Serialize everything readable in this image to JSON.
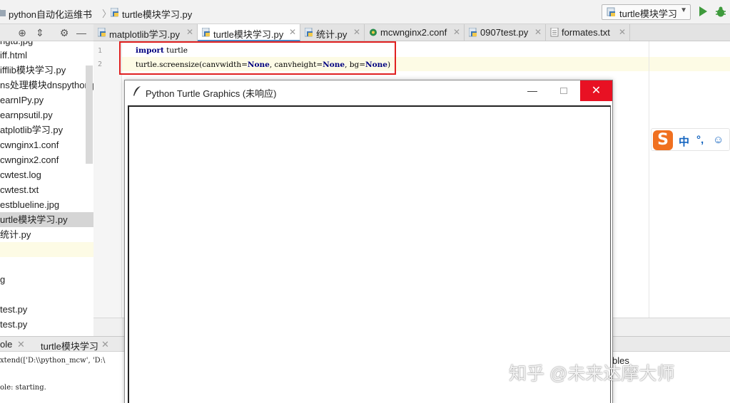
{
  "navbar": {
    "breadcrumb_project": "python自动化运维书",
    "breadcrumb_file": "turtle模块学习.py",
    "run_config": "turtle模块学习"
  },
  "tabs": [
    {
      "label": "matplotlib学习.py"
    },
    {
      "label": "turtle模块学习.py",
      "active": true
    },
    {
      "label": "统计.py"
    },
    {
      "label": "mcwnginx2.conf"
    },
    {
      "label": "0907test.py"
    },
    {
      "label": "formates.txt"
    }
  ],
  "tree": [
    "ngtu.jpg",
    "iff.html",
    "ifflib模块学习.py",
    "ns处理模块dnspython.p",
    "earnIPy.py",
    "earnpsutil.py",
    "atplotlib学习.py",
    "cwnginx1.conf",
    "cwnginx2.conf",
    "cwtest.log",
    "cwtest.txt",
    "estblueline.jpg",
    "urtle模块学习.py",
    "统计.py",
    "",
    "",
    "g",
    "",
    "test.py",
    "test.py"
  ],
  "editor": {
    "line_numbers": [
      "1",
      "2"
    ],
    "line1_kw": "import",
    "line1_rest": " turtle",
    "line2_prefix": "turtle.screensize(canvwidth=",
    "line2_none1": "None",
    "line2_mid1": ", canvheight=",
    "line2_none2": "None",
    "line2_mid2": ", bg=",
    "line2_none3": "None",
    "line2_end": ")"
  },
  "run_panel": {
    "tab1": "ole",
    "tab2": "turtle模块学习",
    "console_line1": "xtend(['D:\\\\python_mcw', 'D:\\",
    "console_line2": "ole: starting.",
    "variables": "bles"
  },
  "turtle_window": {
    "title": "Python Turtle Graphics (未响应)",
    "minimize": "—",
    "close": "✕"
  },
  "ime": {
    "logo": "S",
    "text1": "中",
    "text2": "°,",
    "text3": "☺"
  },
  "watermark": "知乎 @未来达摩大师",
  "colors": {
    "accent": "#4a88c7",
    "highlight_box": "#e02020",
    "close_red": "#e81123",
    "run_green": "#3e9a3c",
    "ime_orange": "#f07020"
  }
}
